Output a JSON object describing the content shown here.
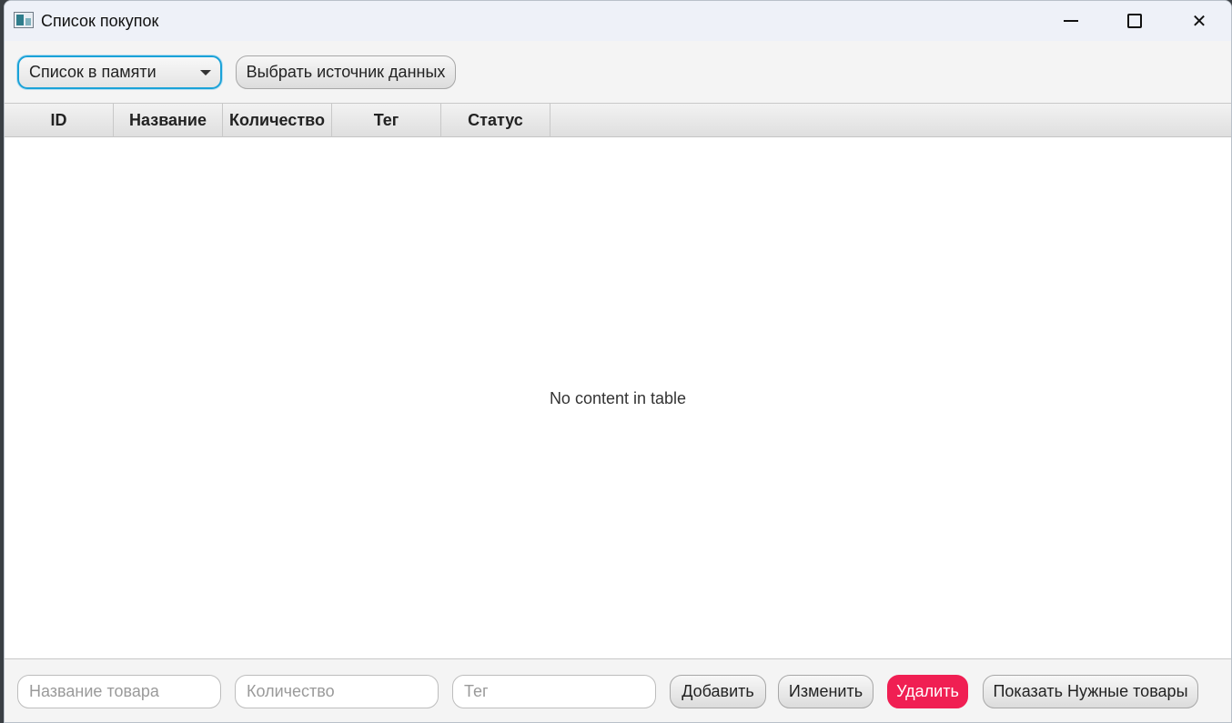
{
  "window": {
    "title": "Список покупок",
    "controls": [
      "minimize-icon",
      "maximize-icon",
      "close-icon"
    ]
  },
  "toolbar": {
    "source_select": {
      "value": "Список в памяти"
    },
    "choose_source_label": "Выбрать источник данных"
  },
  "table": {
    "columns": [
      "ID",
      "Название",
      "Количество",
      "Тег",
      "Статус"
    ],
    "empty_text": "No content in table"
  },
  "form": {
    "name_placeholder": "Название товара",
    "quantity_placeholder": "Количество",
    "tag_placeholder": "Тег",
    "add_label": "Добавить",
    "edit_label": "Изменить",
    "delete_label": "Удалить",
    "show_needed_label": "Показать Нужные товары"
  },
  "colors": {
    "accent": "#1aa2d8",
    "delete": "#f01f53"
  }
}
